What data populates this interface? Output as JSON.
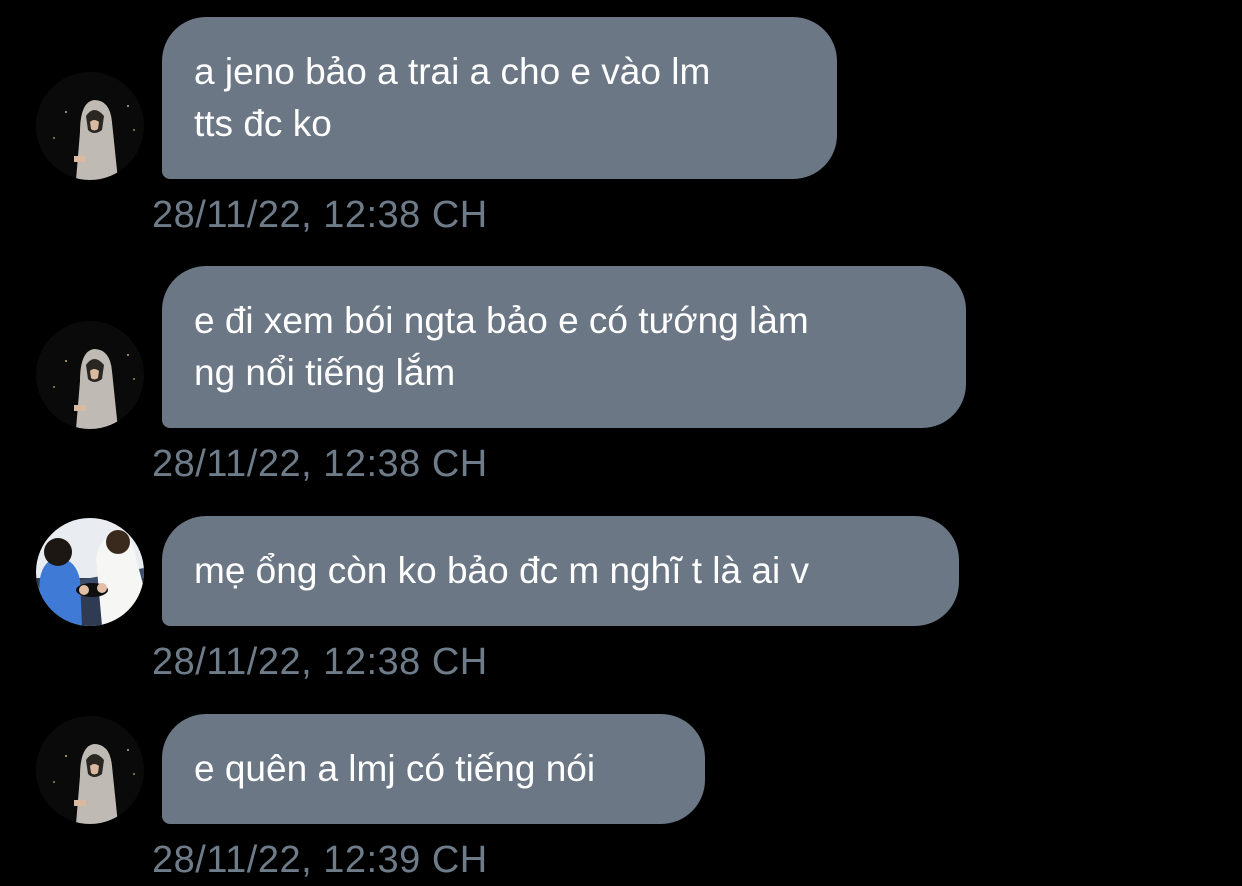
{
  "messages": [
    {
      "sender_avatar": "avatar-hooded-figure",
      "text": "a jeno bảo a trai a cho e vào lm\ntts đc ko",
      "timestamp": "28/11/22, 12:38 CH"
    },
    {
      "sender_avatar": "avatar-hooded-figure",
      "text": "e đi xem bói ngta bảo e có tướng làm\nng nổi tiếng lắm",
      "timestamp": "28/11/22, 12:38 CH"
    },
    {
      "sender_avatar": "avatar-two-people",
      "text": "mẹ ổng còn ko bảo đc m nghĩ t là ai v",
      "timestamp": "28/11/22, 12:38 CH"
    },
    {
      "sender_avatar": "avatar-hooded-figure",
      "text": "e quên a lmj có tiếng nói",
      "timestamp": "28/11/22, 12:39 CH"
    }
  ],
  "colors": {
    "background": "#000000",
    "bubble": "#6b7784",
    "bubble_text": "#ffffff",
    "timestamp": "#6e7b89"
  }
}
